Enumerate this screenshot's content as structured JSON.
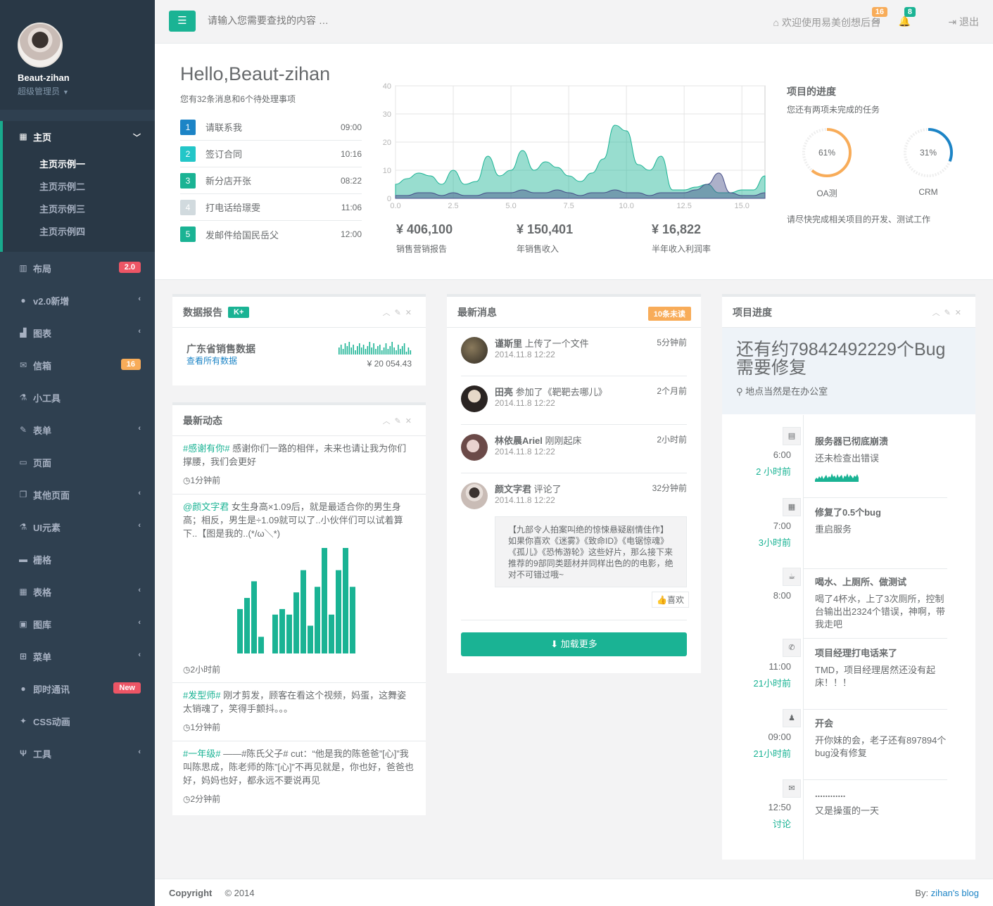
{
  "user": {
    "name": "Beaut-zihan",
    "role": "超级管理员"
  },
  "nav": {
    "main": {
      "label": "主页",
      "subs": [
        "主页示例一",
        "主页示例二",
        "主页示例三",
        "主页示例四"
      ]
    },
    "items": [
      {
        "label": "布局",
        "badge": "2.0"
      },
      {
        "label": "v2.0新增"
      },
      {
        "label": "图表"
      },
      {
        "label": "信箱",
        "badge": "16"
      },
      {
        "label": "小工具"
      },
      {
        "label": "表单"
      },
      {
        "label": "页面"
      },
      {
        "label": "其他页面"
      },
      {
        "label": "UI元素"
      },
      {
        "label": "栅格"
      },
      {
        "label": "表格"
      },
      {
        "label": "图库"
      },
      {
        "label": "菜单"
      },
      {
        "label": "即时通讯",
        "badge": "New"
      },
      {
        "label": "CSS动画"
      },
      {
        "label": "工具"
      }
    ]
  },
  "topbar": {
    "search_placeholder": "请输入您需要查找的内容 …",
    "welcome": "欢迎使用易美创想后台",
    "mail_count": "16",
    "alert_count": "8",
    "logout": "退出"
  },
  "hero": {
    "hello": "Hello,Beaut-zihan",
    "sub": "您有32条消息和6个待处理事项",
    "todos": [
      {
        "n": "1",
        "text": "请联系我",
        "time": "09:00",
        "color": "#1c84c6"
      },
      {
        "n": "2",
        "text": "签订合同",
        "time": "10:16",
        "color": "#23c6c8"
      },
      {
        "n": "3",
        "text": "新分店开张",
        "time": "08:22",
        "color": "#1ab394"
      },
      {
        "n": "4",
        "text": "打电话给璟雯",
        "time": "11:06",
        "color": "#d1dade"
      },
      {
        "n": "5",
        "text": "发邮件给国民岳父",
        "time": "12:00",
        "color": "#1ab394"
      }
    ],
    "stats": [
      {
        "value": "¥ 406,100",
        "label": "销售营销报告"
      },
      {
        "value": "¥ 150,401",
        "label": "年销售收入"
      },
      {
        "value": "¥ 16,822",
        "label": "半年收入利润率"
      }
    ],
    "progress": {
      "title": "项目的进度",
      "sub": "您还有两项未完成的任务",
      "note": "请尽快完成相关项目的开发、测试工作",
      "items": [
        {
          "label": "OA测",
          "pct": 61,
          "text": "61%",
          "color": "#f8ac59"
        },
        {
          "label": "CRM",
          "pct": 31,
          "text": "31%",
          "color": "#1c84c6"
        }
      ]
    }
  },
  "chart_data": {
    "type": "area",
    "x": [
      0,
      0.5,
      1,
      1.5,
      2,
      2.5,
      3,
      3.5,
      4,
      4.5,
      5,
      5.5,
      6,
      6.5,
      7,
      7.5,
      8,
      8.5,
      9,
      9.5,
      10,
      10.5,
      11,
      11.5,
      12,
      12.5,
      13,
      13.5,
      14,
      14.5,
      15,
      15.5,
      16
    ],
    "xticks": [
      "0.0",
      "2.5",
      "5.0",
      "7.5",
      "10.0",
      "12.5",
      "15.0"
    ],
    "ylim": [
      0,
      40
    ],
    "yticks": [
      "0",
      "10",
      "20",
      "30",
      "40"
    ],
    "series": [
      {
        "color": "#1ab394",
        "values": [
          5,
          7,
          9,
          8,
          5,
          10,
          5,
          6,
          15,
          8,
          10,
          17,
          10,
          13,
          11,
          8,
          6,
          9,
          14,
          26,
          24,
          12,
          10,
          15,
          3,
          3,
          4,
          5,
          2,
          2,
          3,
          3,
          8
        ]
      },
      {
        "color": "#464f88",
        "values": [
          1,
          1,
          2,
          2,
          1,
          2,
          1,
          1,
          2,
          2,
          2,
          3,
          2,
          2,
          3,
          2,
          1,
          2,
          2,
          3,
          2,
          2,
          1,
          2,
          2,
          2,
          3,
          5,
          9,
          2,
          1,
          1,
          2
        ]
      }
    ]
  },
  "report": {
    "title": "数据报告",
    "label": "K+",
    "name": "广东省销售数据",
    "link": "查看所有数据",
    "amount": "¥ 20 054.43",
    "spark": [
      5,
      7,
      4,
      8,
      6,
      9,
      5,
      7,
      3,
      6,
      8,
      5,
      7,
      4,
      6,
      9,
      5,
      8,
      4,
      6,
      7,
      3,
      5,
      8,
      4,
      6,
      9,
      5,
      3,
      7,
      4,
      6,
      8,
      2,
      5,
      3
    ]
  },
  "activity": {
    "title": "最新动态",
    "items": [
      {
        "tag": "#感谢有你#",
        "text": " 感谢你们一路的相伴，未来也请让我为你们撑腰，我们会更好",
        "when": "1分钟前"
      },
      {
        "tag": "@颜文字君",
        "text": " 女生身高×1.09后，就是最适合你的男生身高；相反，男生是÷1.09就可以了..小伙伴们可以试着算下..【图是我的..(*/ω＼*)",
        "when": "2小时前"
      },
      {
        "tag": "#发型师#",
        "text": " 刚才剪发，顾客在看这个视频，妈蛋，这舞姿太销魂了，笑得手颤抖。。。",
        "when": "1分钟前"
      },
      {
        "tag": "#一年级#",
        "text": " ——#陈氏父子# cut：“他是我的陈爸爸”[心]”我叫陈思成，陈老师的陈”[心]”不再见就是，你也好，爸爸也好，妈妈也好，都永远不要说再见",
        "when": "2分钟前"
      }
    ],
    "bars": [
      8,
      10,
      13,
      3,
      0,
      7,
      8,
      7,
      11,
      15,
      5,
      12,
      19,
      7,
      15,
      19,
      12
    ]
  },
  "messages": {
    "title": "最新消息",
    "label": "10条未读",
    "items": [
      {
        "name": "谨斯里",
        "action": "上传了一个文件",
        "date": "2014.11.8 12:22",
        "ago": "5分钟前"
      },
      {
        "name": "田亮",
        "action": "参加了《靶靶去哪儿》",
        "date": "2014.11.8 12:22",
        "ago": "2个月前"
      },
      {
        "name": "林依晨Ariel",
        "action": "刚刚起床",
        "date": "2014.11.8 12:22",
        "ago": "2小时前"
      },
      {
        "name": "颜文字君",
        "action": "评论了",
        "date": "2014.11.8 12:22",
        "ago": "32分钟前"
      }
    ],
    "quote": "【九部令人拍案叫绝的惊悚悬疑剧情佳作】如果你喜欢《迷雾》《致命ID》《电锯惊魂》《孤儿》《恐怖游轮》这些好片，那么接下来推荐的9部同类题材并同样出色的的电影，绝对不可错过哦~",
    "like": "喜欢",
    "load": "加载更多"
  },
  "timeline": {
    "title": "项目进度",
    "bug": "还有约79842492229个Bug需要修复",
    "location": "地点当然是在办公室",
    "items": [
      {
        "time": "6:00",
        "ago": "2 小时前",
        "title": "服务器已彻底崩溃",
        "text": "还未检查出错误",
        "icon": "briefcase-icon",
        "glyph": "▤"
      },
      {
        "time": "7:00",
        "ago": "3小时前",
        "title": "修复了0.5个bug",
        "text": "重启服务",
        "icon": "file-icon",
        "glyph": "▦"
      },
      {
        "time": "8:00",
        "ago": "",
        "title": "喝水、上厕所、做测试",
        "text": "喝了4杯水，上了3次厕所，控制台输出出2324个错误，神啊，带我走吧",
        "icon": "coffee-icon",
        "glyph": "☕"
      },
      {
        "time": "11:00",
        "ago": "21小时前",
        "title": "项目经理打电话来了",
        "text": "TMD，项目经理居然还没有起床！！！",
        "icon": "phone-icon",
        "glyph": "✆"
      },
      {
        "time": "09:00",
        "ago": "21小时前",
        "title": "开会",
        "text": "开你妹的会，老子还有897894个bug没有修复",
        "icon": "user-icon",
        "glyph": "♟"
      },
      {
        "time": "12:50",
        "ago": "讨论",
        "title": "............",
        "text": "又是操蛋的一天",
        "icon": "comments-icon",
        "glyph": "✉"
      }
    ]
  },
  "footer": {
    "copyright": "Copyright",
    "year": "© 2014",
    "by": "By:",
    "blog": "zihan's blog"
  }
}
